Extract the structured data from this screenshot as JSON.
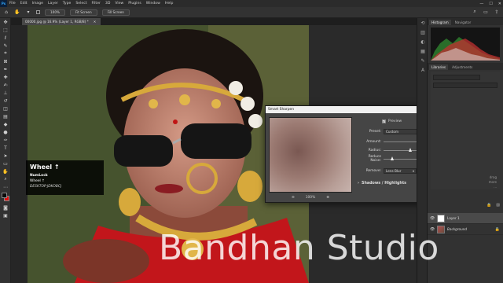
{
  "menubar": {
    "logo": "Ps",
    "items": [
      "File",
      "Edit",
      "Image",
      "Layer",
      "Type",
      "Select",
      "Filter",
      "3D",
      "View",
      "Plugins",
      "Window",
      "Help"
    ],
    "controls": [
      "—",
      "☐",
      "✕"
    ]
  },
  "options_bar": {
    "zoom_btn": "100%",
    "fit_btn": "Fit Screen",
    "fill_btn": "Fill Screen"
  },
  "document": {
    "tab_title": "00000.jpg @ 16.9% (Layer 1, RGB/8) *",
    "tab_close": "✕"
  },
  "caption": {
    "title": "Wheel ↑",
    "line1": "NumLock",
    "line2": "Wheel ↑",
    "line3": "DESKTOP-JDKOBCJ"
  },
  "dialog": {
    "title": "Smart Sharpen",
    "close": "✕",
    "preview_label": "Preview",
    "preview_checked": "✓",
    "ok_label": "OK",
    "cancel_label": "Cancel",
    "zoom_out": "⊖",
    "zoom_level": "100%",
    "zoom_in": "⊕",
    "preset": {
      "label": "Preset:",
      "value": "Custom"
    },
    "amount": {
      "label": "Amount:",
      "value": "500",
      "unit": "%",
      "fraction": 0.98
    },
    "radius": {
      "label": "Radius:",
      "value": "10.5",
      "unit": "px",
      "fraction": 0.55
    },
    "reduce_noise": {
      "label": "Reduce Noise:",
      "value": "18",
      "unit": "%",
      "fraction": 0.18
    },
    "remove": {
      "label": "Remove:",
      "value": "Lens Blur",
      "angle": "0"
    },
    "shadows_highlights": "Shadows / Highlights",
    "shadows_caret": "›"
  },
  "panels": {
    "histogram_tab": "Histogram",
    "navigator_tab": "Navigator",
    "libraries_tab": "Libraries",
    "adjustments_tab": "Adjustments",
    "lib_text": "drag\nmore\n...",
    "layers": [
      {
        "name": "Layer 1",
        "eye": "👁",
        "selected": true
      },
      {
        "name": "Background",
        "eye": "👁",
        "selected": false
      }
    ]
  },
  "watermark": "Bandhan Studio",
  "colors": {
    "accent": "#31a8ff",
    "foreground_swatch": "#0a0a0a",
    "background_swatch": "#e01010"
  }
}
